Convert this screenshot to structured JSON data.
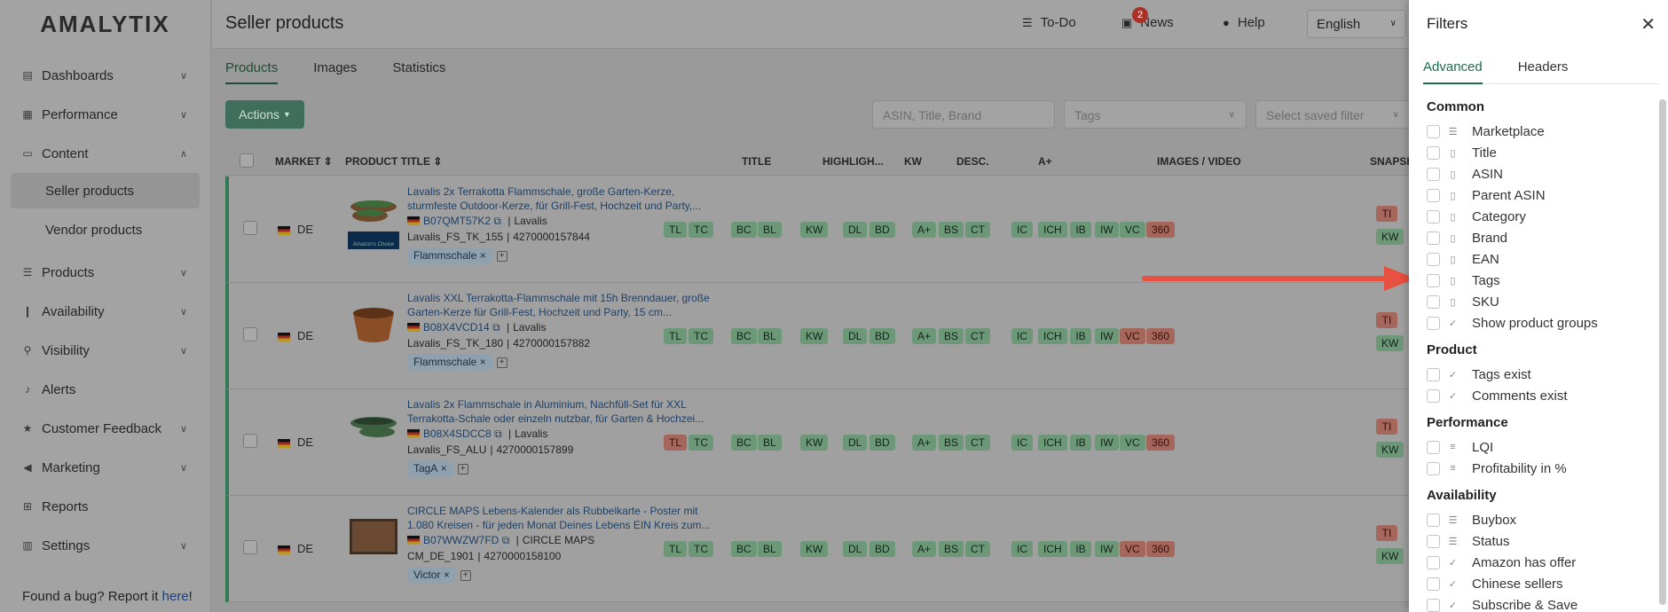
{
  "sidebar": {
    "logo": "AMALYTIX",
    "items": [
      {
        "label": "Dashboards",
        "icon": "dashboard-icon"
      },
      {
        "label": "Performance",
        "icon": "performance-icon"
      },
      {
        "label": "Content",
        "icon": "content-icon"
      },
      {
        "label": "Products",
        "icon": "list-icon"
      },
      {
        "label": "Availability",
        "icon": "thermometer-icon"
      },
      {
        "label": "Visibility",
        "icon": "search-icon"
      },
      {
        "label": "Alerts",
        "icon": "bell-icon"
      },
      {
        "label": "Customer Feedback",
        "icon": "star-icon"
      },
      {
        "label": "Marketing",
        "icon": "megaphone-icon"
      },
      {
        "label": "Reports",
        "icon": "table-icon"
      },
      {
        "label": "Settings",
        "icon": "settings-icon"
      }
    ],
    "content_sub": [
      "Seller products",
      "Vendor products"
    ],
    "bug_text": "Found a bug? Report it ",
    "bug_link": "here",
    "bug_end": "!"
  },
  "topbar": {
    "title": "Seller products",
    "todo": "To-Do",
    "news": "News",
    "news_count": "2",
    "help": "Help",
    "language": "English"
  },
  "tabs": [
    "Products",
    "Images",
    "Statistics"
  ],
  "toolbar": {
    "actions": "Actions",
    "search_placeholder": "ASIN, Title, Brand",
    "tags_placeholder": "Tags",
    "saved_filter_placeholder": "Select saved filter"
  },
  "table": {
    "headers": {
      "market": "MARKET",
      "product_title": "PRODUCT TITLE",
      "title": "TITLE",
      "highlights": "HIGHLIGH...",
      "kw": "KW",
      "desc": "DESC.",
      "aplus": "A+",
      "images": "IMAGES / VIDEO",
      "snapshot": "SNAPSH"
    },
    "rows": [
      {
        "market": "DE",
        "title_line1": "Lavalis 2x Terrakotta Flammschale, große Garten-Kerze,",
        "title_line2": "sturmfeste Outdoor-Kerze, für Grill-Fest, Hochzeit und Party,...",
        "asin": "B07QMT57K2",
        "brand": "Lavalis",
        "sku": "Lavalis_FS_TK_155",
        "ean": "4270000157844",
        "tag": "Flammschale",
        "tl_red": false,
        "vc_red": false,
        "badge": "Amazon's Choice"
      },
      {
        "market": "DE",
        "title_line1": "Lavalis XXL Terrakotta-Flammschale mit 15h Brenndauer, große",
        "title_line2": "Garten-Kerze für Grill-Fest, Hochzeit und Party, 15 cm...",
        "asin": "B08X4VCD14",
        "brand": "Lavalis",
        "sku": "Lavalis_FS_TK_180",
        "ean": "4270000157882",
        "tag": "Flammschale",
        "tl_red": false,
        "vc_red": true,
        "badge": ""
      },
      {
        "market": "DE",
        "title_line1": "Lavalis 2x Flammschale in Aluminium, Nachfüll-Set für XXL",
        "title_line2": "Terrakotta-Schale oder einzeln nutzbar, für Garten & Hochzei...",
        "asin": "B08X4SDCC8",
        "brand": "Lavalis",
        "sku": "Lavalis_FS_ALU",
        "ean": "4270000157899",
        "tag": "TagA",
        "tl_red": true,
        "vc_red": false,
        "badge": ""
      },
      {
        "market": "DE",
        "title_line1": "CIRCLE MAPS Lebens-Kalender als Rubbelkarte - Poster mit",
        "title_line2": "1.080 Kreisen - für jeden Monat Deines Lebens EIN Kreis zum...",
        "asin": "B07WWZW7FD",
        "brand": "CIRCLE MAPS",
        "sku": "CM_DE_1901",
        "ean": "4270000158100",
        "tag": "Victor",
        "tl_red": false,
        "vc_red": true,
        "badge": ""
      }
    ],
    "pills": {
      "tl": "TL",
      "tc": "TC",
      "bc": "BC",
      "bl": "BL",
      "kw": "KW",
      "dl": "DL",
      "bd": "BD",
      "aplus": "A+",
      "bs": "BS",
      "ct": "CT",
      "ic": "IC",
      "ich": "ICH",
      "ib": "IB",
      "iw": "IW",
      "vc": "VC",
      "n360": "360",
      "ti": "TI"
    }
  },
  "filters": {
    "title": "Filters",
    "tabs": [
      "Advanced",
      "Headers"
    ],
    "sections": [
      {
        "title": "Common",
        "options": [
          {
            "label": "Marketplace",
            "icon": "list-icon"
          },
          {
            "label": "Title",
            "icon": "doc-icon"
          },
          {
            "label": "ASIN",
            "icon": "doc-icon"
          },
          {
            "label": "Parent ASIN",
            "icon": "doc-icon"
          },
          {
            "label": "Category",
            "icon": "doc-icon"
          },
          {
            "label": "Brand",
            "icon": "doc-icon"
          },
          {
            "label": "EAN",
            "icon": "doc-icon"
          },
          {
            "label": "Tags",
            "icon": "doc-icon"
          },
          {
            "label": "SKU",
            "icon": "doc-icon"
          },
          {
            "label": "Show product groups",
            "icon": "check-circle-icon"
          }
        ]
      },
      {
        "title": "Product",
        "options": [
          {
            "label": "Tags exist",
            "icon": "check-circle-icon"
          },
          {
            "label": "Comments exist",
            "icon": "check-circle-icon"
          }
        ]
      },
      {
        "title": "Performance",
        "options": [
          {
            "label": "LQI",
            "icon": "lines-icon"
          },
          {
            "label": "Profitability in %",
            "icon": "lines-icon"
          }
        ]
      },
      {
        "title": "Availability",
        "options": [
          {
            "label": "Buybox",
            "icon": "list-icon"
          },
          {
            "label": "Status",
            "icon": "list-icon"
          },
          {
            "label": "Amazon has offer",
            "icon": "check-circle-icon"
          },
          {
            "label": "Chinese sellers",
            "icon": "check-circle-icon"
          },
          {
            "label": "Subscribe & Save",
            "icon": "check-circle-icon"
          }
        ]
      }
    ]
  },
  "colors": {
    "accent": "#1e6b4e",
    "arrow": "#e8503f",
    "link": "#1e4066"
  }
}
